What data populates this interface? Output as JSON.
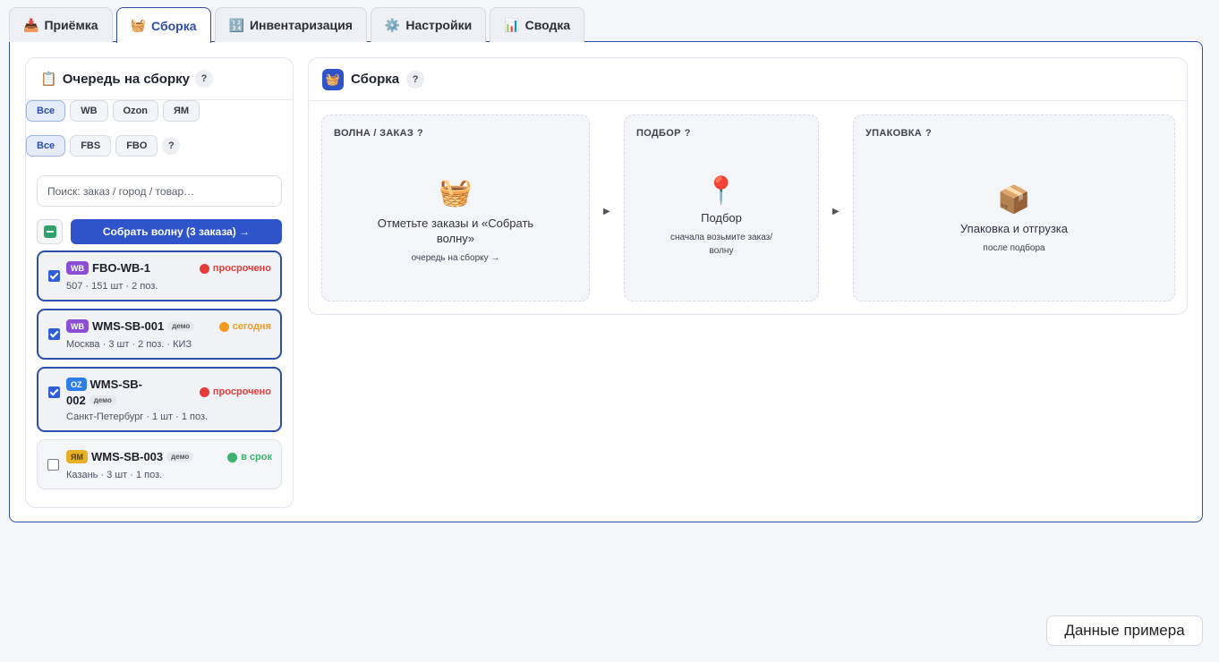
{
  "tabs": [
    {
      "icon": "📥",
      "label": "Приёмка"
    },
    {
      "icon": "🧺",
      "label": "Сборка"
    },
    {
      "icon": "🔢",
      "label": "Инвентаризация"
    },
    {
      "icon": "⚙️",
      "label": "Настройки"
    },
    {
      "icon": "📊",
      "label": "Сводка"
    }
  ],
  "active_tab": "Сборка",
  "queue": {
    "icon": "📋",
    "title": "Очередь на сборку",
    "help": "?",
    "marketplace_filters": [
      "Все",
      "WB",
      "Ozon",
      "ЯМ"
    ],
    "scheme_filters": [
      "Все",
      "FBS",
      "FBO"
    ],
    "search_placeholder": "Поиск: заказ / город / товар…",
    "wave_button": "Собрать волну (3 заказа) →",
    "orders": [
      {
        "marketplace": "WB",
        "id": "FBO-WB-1",
        "demo": "",
        "status": "просрочено",
        "status_color": "#e53b3b",
        "meta": "507 · 151 шт · 2 поз.",
        "checked": true
      },
      {
        "marketplace": "WB",
        "id": "WMS-SB-001",
        "demo": "демо",
        "status": "сегодня",
        "status_color": "#f29b1d",
        "meta": "Москва · 3 шт · 2 поз. · КИЗ",
        "checked": true
      },
      {
        "marketplace": "OZ",
        "id_line1": "WMS-SB-",
        "id_line2": "002",
        "demo": "демо",
        "status": "просрочено",
        "status_color": "#e53b3b",
        "meta": "Санкт-Петербург · 1 шт · 1 поз.",
        "checked": true
      },
      {
        "marketplace": "ЯМ",
        "id": "WMS-SB-003",
        "demo": "демо",
        "status": "в срок",
        "status_color": "#3bb36a",
        "meta": "Казань · 3 шт · 1 поз.",
        "checked": false
      }
    ]
  },
  "assembly": {
    "icon": "🧺",
    "title": "Сборка",
    "help": "?",
    "stages": [
      {
        "title": "ВОЛНА / ЗАКАЗ",
        "emoji": "🧺",
        "main": "Отметьте заказы и «Собрать волну»",
        "sub": "очередь на сборку →"
      },
      {
        "title": "ПОДБОР",
        "emoji": "📍",
        "main": "Подбор",
        "sub": "сначала возьмите заказ/волну"
      },
      {
        "title": "УПАКОВКА",
        "emoji": "📦",
        "main": "Упаковка и отгрузка",
        "sub": "после подбора"
      }
    ],
    "arrow": "▶"
  },
  "sample_button": "Данные примера"
}
